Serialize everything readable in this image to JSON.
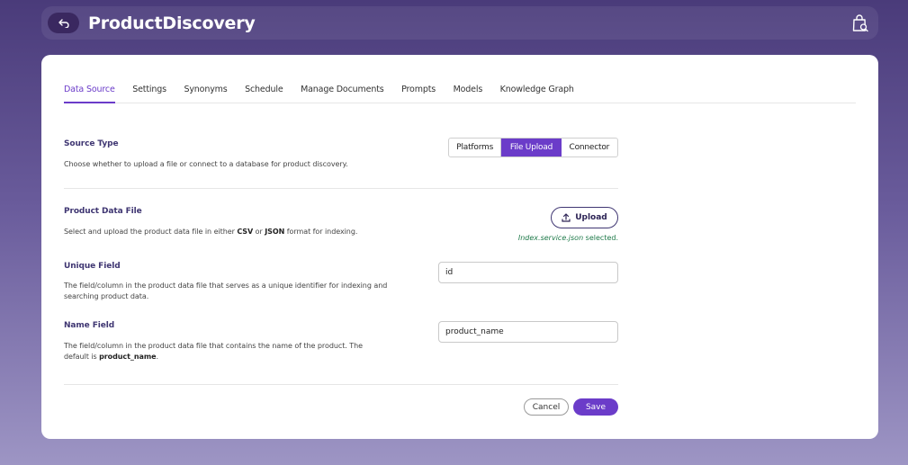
{
  "header": {
    "title": "ProductDiscovery",
    "back_icon": "back-arrow-icon",
    "right_icon": "shopping-bag-search-icon"
  },
  "tabs": [
    {
      "label": "Data Source",
      "active": true
    },
    {
      "label": "Settings",
      "active": false
    },
    {
      "label": "Synonyms",
      "active": false
    },
    {
      "label": "Schedule",
      "active": false
    },
    {
      "label": "Manage Documents",
      "active": false
    },
    {
      "label": "Prompts",
      "active": false
    },
    {
      "label": "Models",
      "active": false
    },
    {
      "label": "Knowledge Graph",
      "active": false
    }
  ],
  "source_type": {
    "label": "Source Type",
    "description": "Choose whether to upload a file or connect to a database for product discovery.",
    "options": [
      "Platforms",
      "File Upload",
      "Connector"
    ],
    "selected": "File Upload"
  },
  "product_file": {
    "label": "Product Data File",
    "description_pre": "Select and upload the product data file in either ",
    "fmt1": "CSV",
    "description_mid": " or ",
    "fmt2": "JSON",
    "description_post": " format for indexing.",
    "upload_label": "Upload",
    "selected_file": "Index.service.json",
    "selected_suffix": " selected."
  },
  "unique_field": {
    "label": "Unique Field",
    "description": "The field/column in the product data file that serves as a unique identifier for indexing and searching product data.",
    "value": "id"
  },
  "name_field": {
    "label": "Name Field",
    "description_pre": "The field/column in the product data file that contains the name of the product. The default is ",
    "default": "product_name",
    "description_post": ".",
    "value": "product_name"
  },
  "actions": {
    "cancel": "Cancel",
    "save": "Save"
  },
  "colors": {
    "accent": "#6b3cc9",
    "dark_accent": "#3f3672",
    "success": "#1f7a4a"
  }
}
